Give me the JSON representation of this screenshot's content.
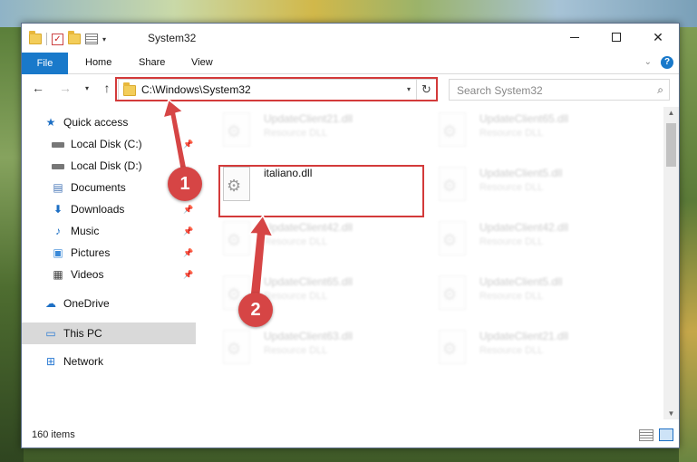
{
  "window": {
    "title": "System32",
    "controls": {
      "minimize": "—",
      "maximize": "☐",
      "close": "✕"
    }
  },
  "ribbon": {
    "tabs": [
      "File",
      "Home",
      "Share",
      "View"
    ],
    "help": "?"
  },
  "nav": {
    "back": "←",
    "forward": "→",
    "recent": "▾",
    "up": "↑",
    "address": "C:\\Windows\\System32",
    "refresh": "↻",
    "search_placeholder": "Search System32"
  },
  "sidebar": {
    "items": [
      {
        "label": "Quick access",
        "icon": "star-icon",
        "pinned": false
      },
      {
        "label": "Local Disk (C:)",
        "icon": "disk-icon",
        "pinned": true
      },
      {
        "label": "Local Disk (D:)",
        "icon": "disk-icon",
        "pinned": false
      },
      {
        "label": "Documents",
        "icon": "documents-icon",
        "pinned": false
      },
      {
        "label": "Downloads",
        "icon": "downloads-icon",
        "pinned": true
      },
      {
        "label": "Music",
        "icon": "music-icon",
        "pinned": true
      },
      {
        "label": "Pictures",
        "icon": "pictures-icon",
        "pinned": true
      },
      {
        "label": "Videos",
        "icon": "videos-icon",
        "pinned": true
      },
      {
        "label": "OneDrive",
        "icon": "onedrive-icon",
        "pinned": false
      },
      {
        "label": "This PC",
        "icon": "this-pc-icon",
        "pinned": false,
        "selected": true
      },
      {
        "label": "Network",
        "icon": "network-icon",
        "pinned": false
      }
    ]
  },
  "files": [
    {
      "name": "UpdateClient21.dll",
      "type": "Resource DLL",
      "faded": true
    },
    {
      "name": "UpdateClient65.dll",
      "type": "Resource DLL",
      "faded": true
    },
    {
      "name": "italiano.dll",
      "type": "",
      "faded": false
    },
    {
      "name": "UpdateClient5.dll",
      "type": "Resource DLL",
      "faded": true
    },
    {
      "name": "UpdateClient42.dll",
      "type": "Resource DLL",
      "faded": true
    },
    {
      "name": "UpdateClient42.dll",
      "type": "Resource DLL",
      "faded": true
    },
    {
      "name": "UpdateClient65.dll",
      "type": "Resource DLL",
      "faded": true
    },
    {
      "name": "UpdateClient5.dll",
      "type": "Resource DLL",
      "faded": true
    },
    {
      "name": "UpdateClient63.dll",
      "type": "Resource DLL",
      "faded": true
    },
    {
      "name": "UpdateClient21.dll",
      "type": "Resource DLL",
      "faded": true
    }
  ],
  "status": {
    "item_count": "160 items"
  },
  "annotations": {
    "step1": "1",
    "step2": "2",
    "color": "#d33a3a"
  }
}
